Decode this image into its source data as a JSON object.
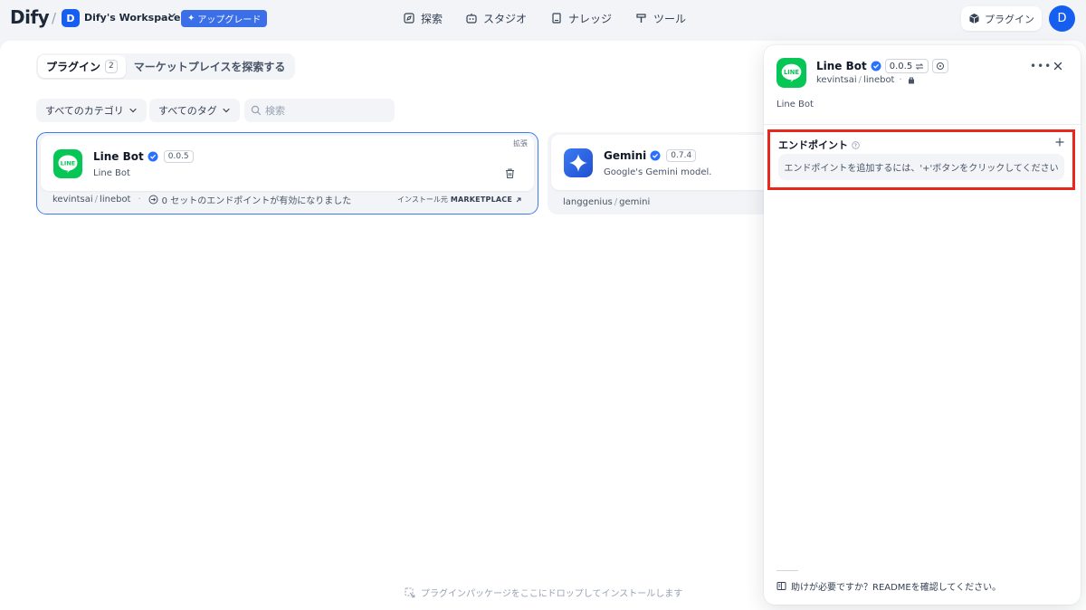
{
  "brand": {
    "logo": "Dify"
  },
  "workspace": {
    "initial": "D",
    "name": "Dify's Workspace",
    "upgrade_label": "アップグレード"
  },
  "nav": [
    {
      "label": "探索",
      "icon": "explore-icon"
    },
    {
      "label": "スタジオ",
      "icon": "robot-icon"
    },
    {
      "label": "ナレッジ",
      "icon": "book-icon"
    },
    {
      "label": "ツール",
      "icon": "hammer-icon"
    }
  ],
  "header_right": {
    "plugin_label": "プラグイン",
    "user_initial": "D"
  },
  "tabs": {
    "plugins_label": "プラグイン",
    "plugins_count": "2",
    "marketplace_label": "マーケットプレイスを探索する"
  },
  "filters": {
    "category_label": "すべてのカテゴリ",
    "tag_label": "すべてのタグ",
    "search_placeholder": "検索"
  },
  "cards": [
    {
      "name": "Line Bot",
      "version": "0.0.5",
      "description": "Line Bot",
      "tag": "拡張",
      "org": "kevintsai",
      "slug": "linebot",
      "endpoints_text": "0 セットのエンドポイントが有効になりました",
      "install_prefix": "インストール元",
      "install_source": "MARKETPLACE"
    },
    {
      "name": "Gemini",
      "version": "0.7.4",
      "description": "Google's Gemini model.",
      "org": "langgenius",
      "slug": "gemini"
    }
  ],
  "drop_hint": "プラグインパッケージをここにドロップしてインストールします",
  "panel": {
    "name": "Line Bot",
    "version": "0.0.5",
    "org": "kevintsai",
    "slug": "linebot",
    "description": "Line Bot",
    "endpoint_title": "エンドポイント",
    "endpoint_empty": "エンドポイントを追加するには、'+'ボタンをクリックしてください",
    "readme_link": "助けが必要ですか？READMEを確認してください。"
  },
  "colors": {
    "accent": "#155eef",
    "line_green": "#06c755",
    "highlight": "#e8271d"
  }
}
